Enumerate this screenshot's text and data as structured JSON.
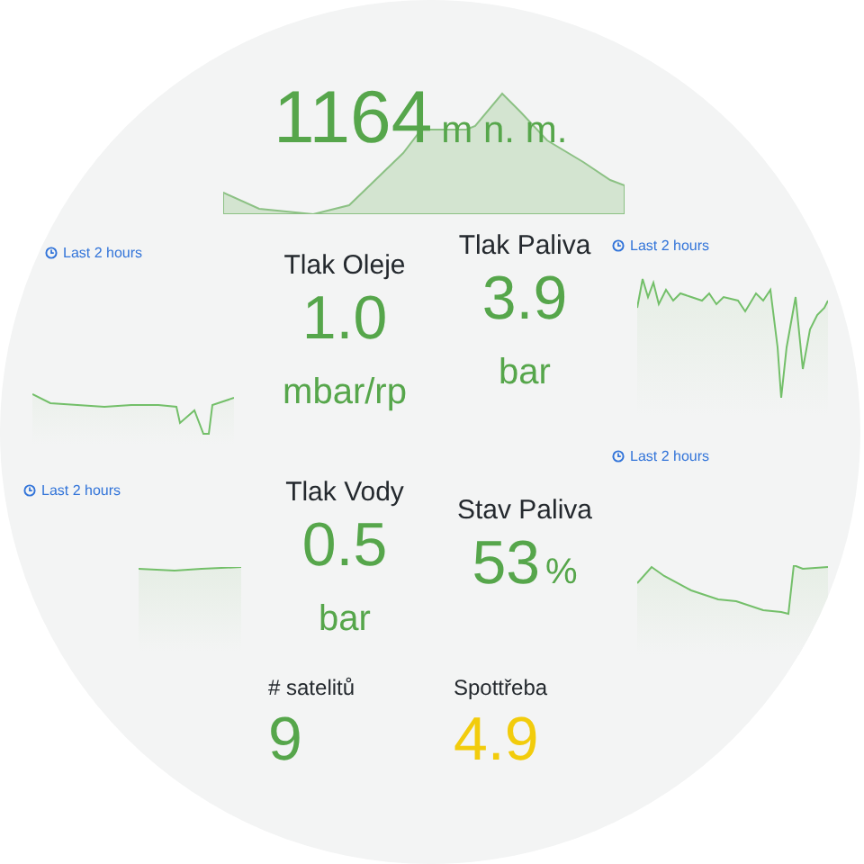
{
  "altitude": {
    "value": "1164",
    "unit": "m n. m.",
    "color": "#56a64b"
  },
  "time_ranges": [
    {
      "label": "Last 2 hours"
    },
    {
      "label": "Last 2 hours"
    },
    {
      "label": "Last 2 hours"
    },
    {
      "label": "Last 2 hours"
    }
  ],
  "stats": [
    {
      "title": "Tlak Oleje",
      "value": "1.0",
      "unit": "mbar/rp",
      "kind": "below",
      "color": "#56a64b"
    },
    {
      "title": "Tlak Paliva",
      "value": "3.9",
      "unit": "bar",
      "kind": "below",
      "color": "#56a64b"
    },
    {
      "title": "Tlak Vody",
      "value": "0.5",
      "unit": "bar",
      "kind": "below",
      "color": "#56a64b"
    },
    {
      "title": "Stav Paliva",
      "value": "53",
      "unit": "%",
      "kind": "inline",
      "color": "#56a64b"
    },
    {
      "title": "# satelitů",
      "value": "9",
      "kind": "small",
      "color": "#56a64b"
    },
    {
      "title": "Spottřeba",
      "value": "4.9",
      "kind": "small",
      "color": "#f2cc0c"
    }
  ]
}
